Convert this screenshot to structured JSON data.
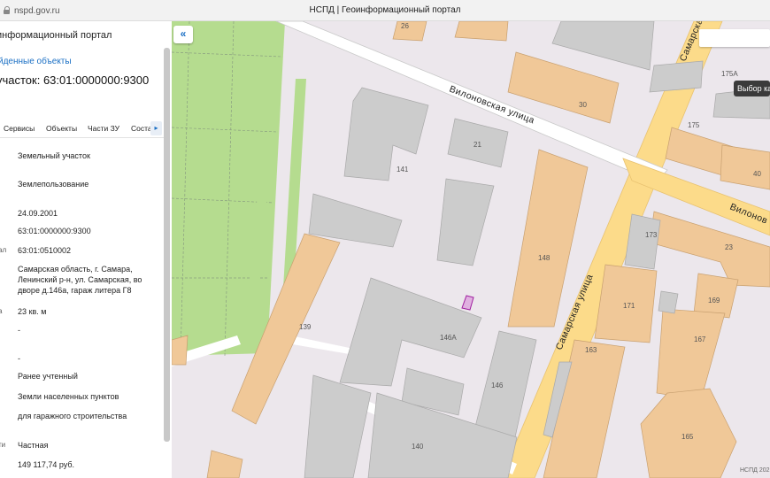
{
  "browser": {
    "url": "nspd.gov.ru",
    "title": "НСПД | Геоинформационный портал"
  },
  "panel": {
    "portal_title": "информационный портал",
    "found_link": "йденные объекты",
    "object_heading": "участок: 63:01:0000000:9300",
    "tabs": [
      "Сервисы",
      "Объекты",
      "Части ЗУ",
      "Соста"
    ],
    "rows": [
      {
        "label": "",
        "value": "Земельный участок"
      },
      {
        "label": "",
        "value": "Землепользование"
      },
      {
        "label": "",
        "value": "24.09.2001"
      },
      {
        "label": "",
        "value": "63:01:0000000:9300"
      },
      {
        "label": "ал",
        "value": "63:01:0510002"
      },
      {
        "label": "",
        "value": "Самарская область, г. Самара,\nЛенинский р-н, ул. Самарская, во\nдворе д.146а, гараж литера Г8"
      },
      {
        "label": "а",
        "value": "23 кв. м"
      },
      {
        "label": "",
        "value": "-"
      },
      {
        "label": "",
        "value": "-"
      },
      {
        "label": "",
        "value": "Ранее учтенный"
      },
      {
        "label": "",
        "value": "Земли населенных пунктов"
      },
      {
        "label": "",
        "value": "для гаражного строительства"
      },
      {
        "label": "ти",
        "value": "Частная"
      },
      {
        "label": "",
        "value": "149 117,74 руб."
      }
    ]
  },
  "map": {
    "streets": [
      "Вилоновская улица",
      "Самарская улица",
      "Самарская",
      "Вилонов"
    ],
    "building_labels": [
      "26",
      "30",
      "175А",
      "175",
      "40",
      "21",
      "141",
      "173",
      "23",
      "148",
      "169",
      "171",
      "167",
      "139",
      "146А",
      "163",
      "146",
      "140",
      "165"
    ],
    "tooltip": "Выбор ка",
    "copyright": "НСПД 202",
    "colors": {
      "residential": "#f0c898",
      "public": "#cccccc",
      "park": "#b5dc8f",
      "road_major": "#fcdb8a"
    }
  }
}
